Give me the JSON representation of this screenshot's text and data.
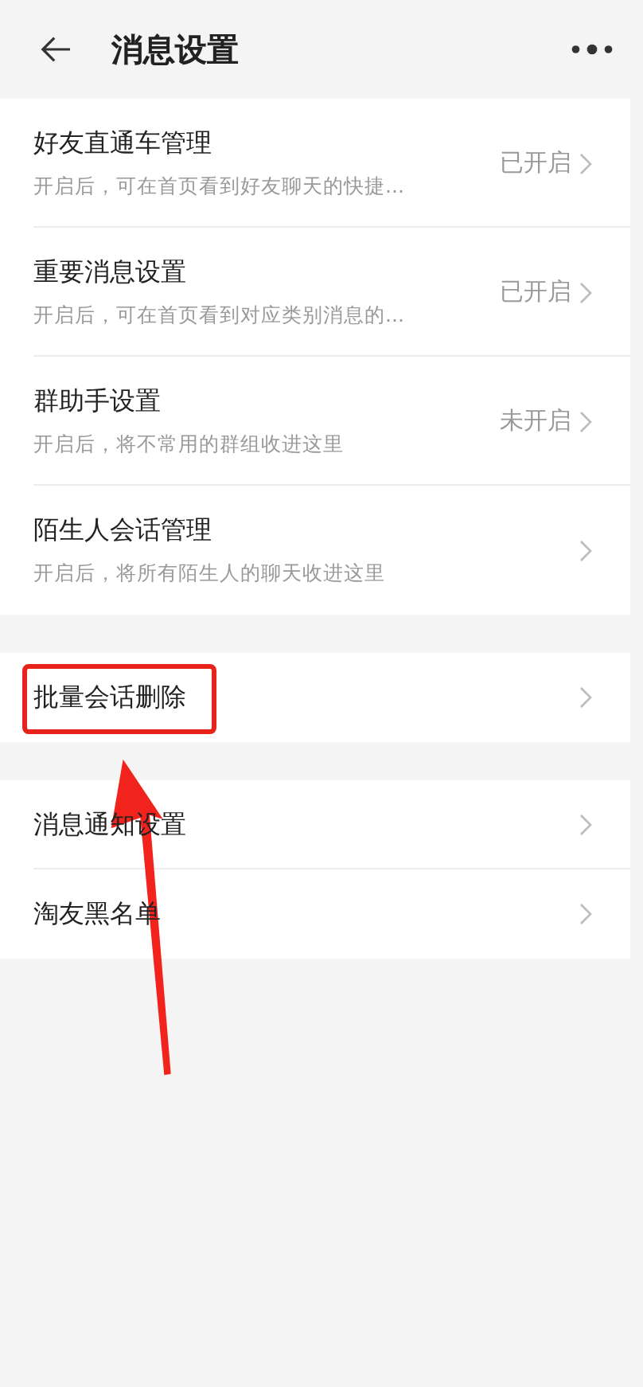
{
  "header": {
    "title": "消息设置"
  },
  "sections": [
    {
      "items": [
        {
          "title": "好友直通车管理",
          "subtitle": "开启后，可在首页看到好友聊天的快捷...",
          "status": "已开启",
          "highlighted": false
        },
        {
          "title": "重要消息设置",
          "subtitle": "开启后，可在首页看到对应类别消息的...",
          "status": "已开启",
          "highlighted": false
        },
        {
          "title": "群助手设置",
          "subtitle": "开启后，将不常用的群组收进这里",
          "status": "未开启",
          "highlighted": false
        },
        {
          "title": "陌生人会话管理",
          "subtitle": "开启后，将所有陌生人的聊天收进这里",
          "highlighted": false
        }
      ]
    },
    {
      "items": [
        {
          "title": "批量会话删除",
          "highlighted": true
        }
      ]
    },
    {
      "items": [
        {
          "title": "消息通知设置",
          "highlighted": false
        },
        {
          "title": "淘友黑名单",
          "highlighted": false
        }
      ]
    }
  ]
}
